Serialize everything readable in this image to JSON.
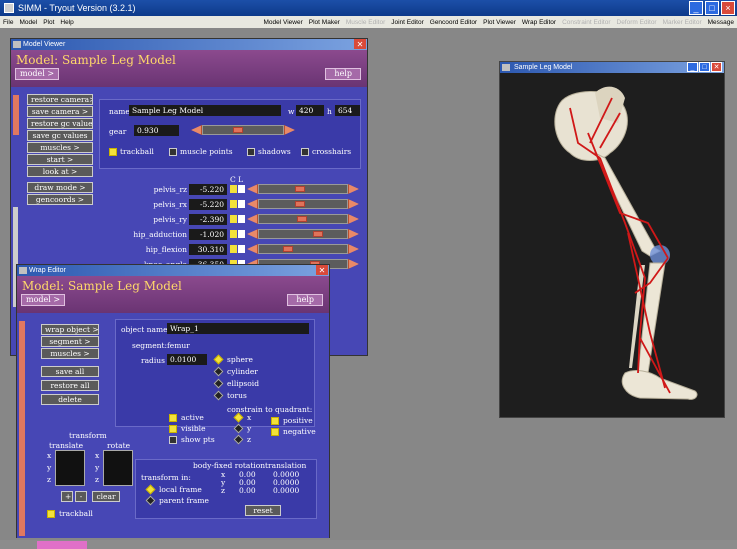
{
  "app": {
    "title": "SIMM - Tryout Version (3.2.1)",
    "menu_left": [
      "File",
      "Model",
      "Plot",
      "Help"
    ],
    "menu_right": [
      {
        "label": "Model Viewer",
        "enabled": true
      },
      {
        "label": "Plot Maker",
        "enabled": true
      },
      {
        "label": "Muscle Editor",
        "enabled": false
      },
      {
        "label": "Joint Editor",
        "enabled": true
      },
      {
        "label": "Gencoord Editor",
        "enabled": true
      },
      {
        "label": "Plot Viewer",
        "enabled": true
      },
      {
        "label": "Wrap Editor",
        "enabled": true
      },
      {
        "label": "Constraint Editor",
        "enabled": false
      },
      {
        "label": "Deform Editor",
        "enabled": false
      },
      {
        "label": "Marker Editor",
        "enabled": false
      },
      {
        "label": "Message",
        "enabled": true
      }
    ],
    "controls": [
      "_",
      "□",
      "×"
    ]
  },
  "model_viewer": {
    "title": "Model Viewer",
    "banner": "Model: Sample Leg Model",
    "model_btn": "model >",
    "help_btn": "help",
    "left_buttons": [
      "restore camera>",
      "save camera >",
      "restore gc values",
      "save gc values",
      "muscles >",
      "start >",
      "look at >",
      "draw mode >",
      "gencoords >"
    ],
    "name_label": "name",
    "name_value": "Sample Leg Model",
    "w_label": "w",
    "w_value": "420",
    "h_label": "h",
    "h_value": "654",
    "gear_label": "gear",
    "gear_value": "0.930",
    "gear_level": 0.42,
    "toggles": [
      {
        "label": "trackball",
        "checked": true
      },
      {
        "label": "muscle points",
        "checked": false
      },
      {
        "label": "shadows",
        "checked": false
      },
      {
        "label": "crosshairs",
        "checked": false
      }
    ],
    "col_header": "C L",
    "gencoords": [
      {
        "name": "pelvis_rz",
        "value": "-5.220",
        "level": 0.45
      },
      {
        "name": "pelvis_rx",
        "value": "-5.220",
        "level": 0.45
      },
      {
        "name": "pelvis_ry",
        "value": "-2.390",
        "level": 0.48
      },
      {
        "name": "hip_adduction",
        "value": "-1.020",
        "level": 0.68
      },
      {
        "name": "hip_flexion",
        "value": "30.310",
        "level": 0.3
      },
      {
        "name": "knee_angle",
        "value": "-36.350",
        "level": 0.64
      }
    ]
  },
  "wrap_editor": {
    "title": "Wrap Editor",
    "banner": "Model: Sample Leg Model",
    "model_btn": "model >",
    "help_btn": "help",
    "left_buttons": [
      "wrap object >",
      "segment >",
      "muscles >",
      "save all",
      "restore all",
      "delete"
    ],
    "object_name_label": "object name",
    "object_name_value": "Wrap_1",
    "segment_label": "segment:",
    "segment_value": "femur",
    "radius_label": "radius",
    "radius_value": "0.0100",
    "shapes": [
      {
        "label": "sphere",
        "selected": true
      },
      {
        "label": "cylinder",
        "selected": false
      },
      {
        "label": "ellipsoid",
        "selected": false
      },
      {
        "label": "torus",
        "selected": false
      }
    ],
    "constrain_label": "constrain to quadrant:",
    "flags": [
      {
        "label": "active",
        "checked": true
      },
      {
        "label": "visible",
        "checked": true
      },
      {
        "label": "show pts",
        "checked": false
      }
    ],
    "axes": [
      {
        "label": "x",
        "selected": true
      },
      {
        "label": "y",
        "selected": false
      },
      {
        "label": "z",
        "selected": false
      }
    ],
    "signs": [
      {
        "label": "positive",
        "checked": true
      },
      {
        "label": "negative",
        "checked": true
      }
    ],
    "transform_label": "transform",
    "translate_label": "translate",
    "rotate_label": "rotate",
    "axis_letters": [
      "x",
      "y",
      "z"
    ],
    "plus": "+",
    "minus": "-",
    "clear": "clear",
    "trackball_label": "trackball",
    "body_fixed_label": "body-fixed rotation",
    "translation_label": "translation",
    "transform_in_label": "transform in:",
    "frames": [
      {
        "label": "local frame",
        "selected": true
      },
      {
        "label": "parent frame",
        "selected": false
      }
    ],
    "rot_values": [
      "0.00",
      "0.00",
      "0.00"
    ],
    "trans_values": [
      "0.0000",
      "0.0000",
      "0.0000"
    ],
    "reset": "reset"
  },
  "sample_window": {
    "title": "Sample Leg Model"
  }
}
